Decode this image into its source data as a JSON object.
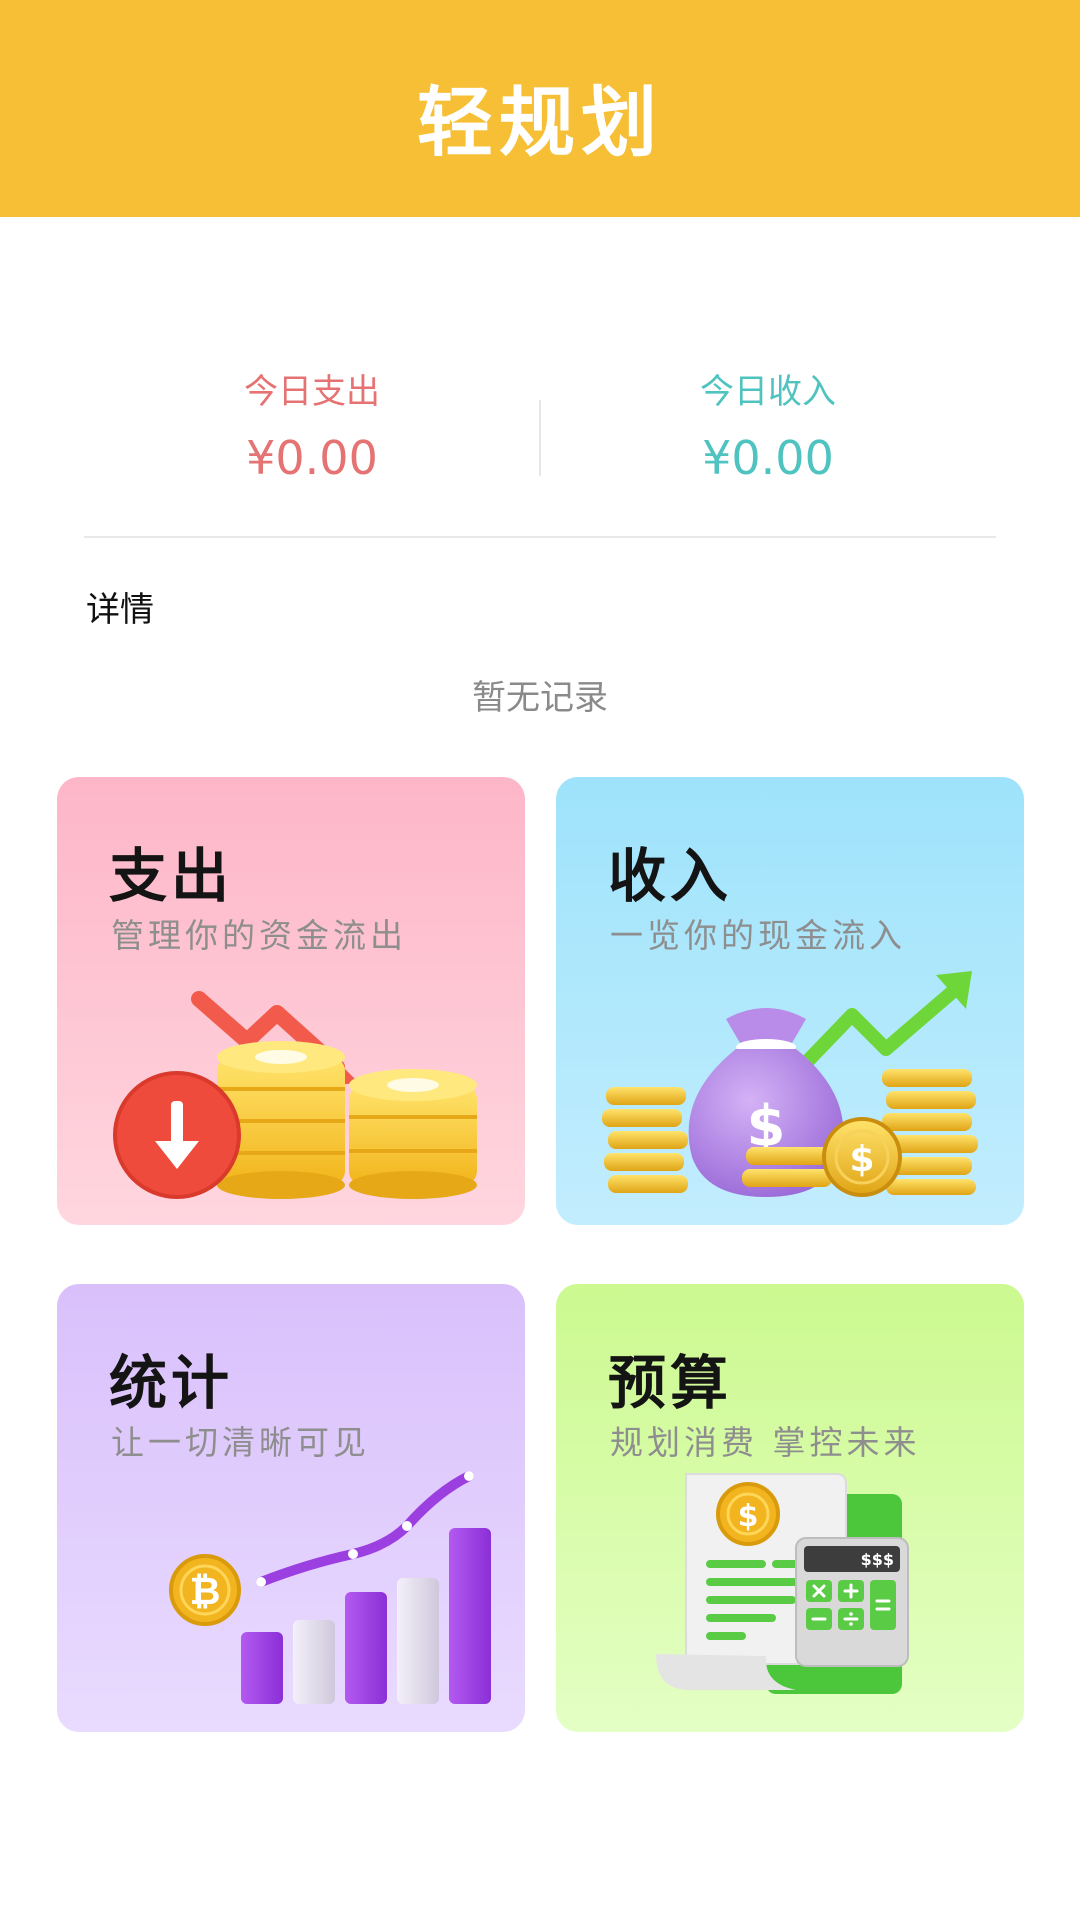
{
  "header": {
    "title": "轻规划"
  },
  "summary": {
    "expense": {
      "label": "今日支出",
      "value": "¥0.00"
    },
    "income": {
      "label": "今日收入",
      "value": "¥0.00"
    }
  },
  "details": {
    "title": "详情",
    "empty": "暂无记录"
  },
  "cards": [
    {
      "title": "支出",
      "subtitle": "管理你的资金流出",
      "icon": "expense-coins-arrow-down-icon"
    },
    {
      "title": "收入",
      "subtitle": "一览你的现金流入",
      "icon": "money-bag-arrow-up-icon"
    },
    {
      "title": "统计",
      "subtitle": "让一切清晰可见",
      "icon": "bar-chart-bitcoin-icon"
    },
    {
      "title": "预算",
      "subtitle": "规划消费 掌控未来",
      "icon": "calculator-receipt-icon"
    }
  ],
  "budget_calc": {
    "display": "$$$"
  },
  "colors": {
    "header": "#f6bf35",
    "expense": "#e57373",
    "income": "#4fc3c0"
  }
}
